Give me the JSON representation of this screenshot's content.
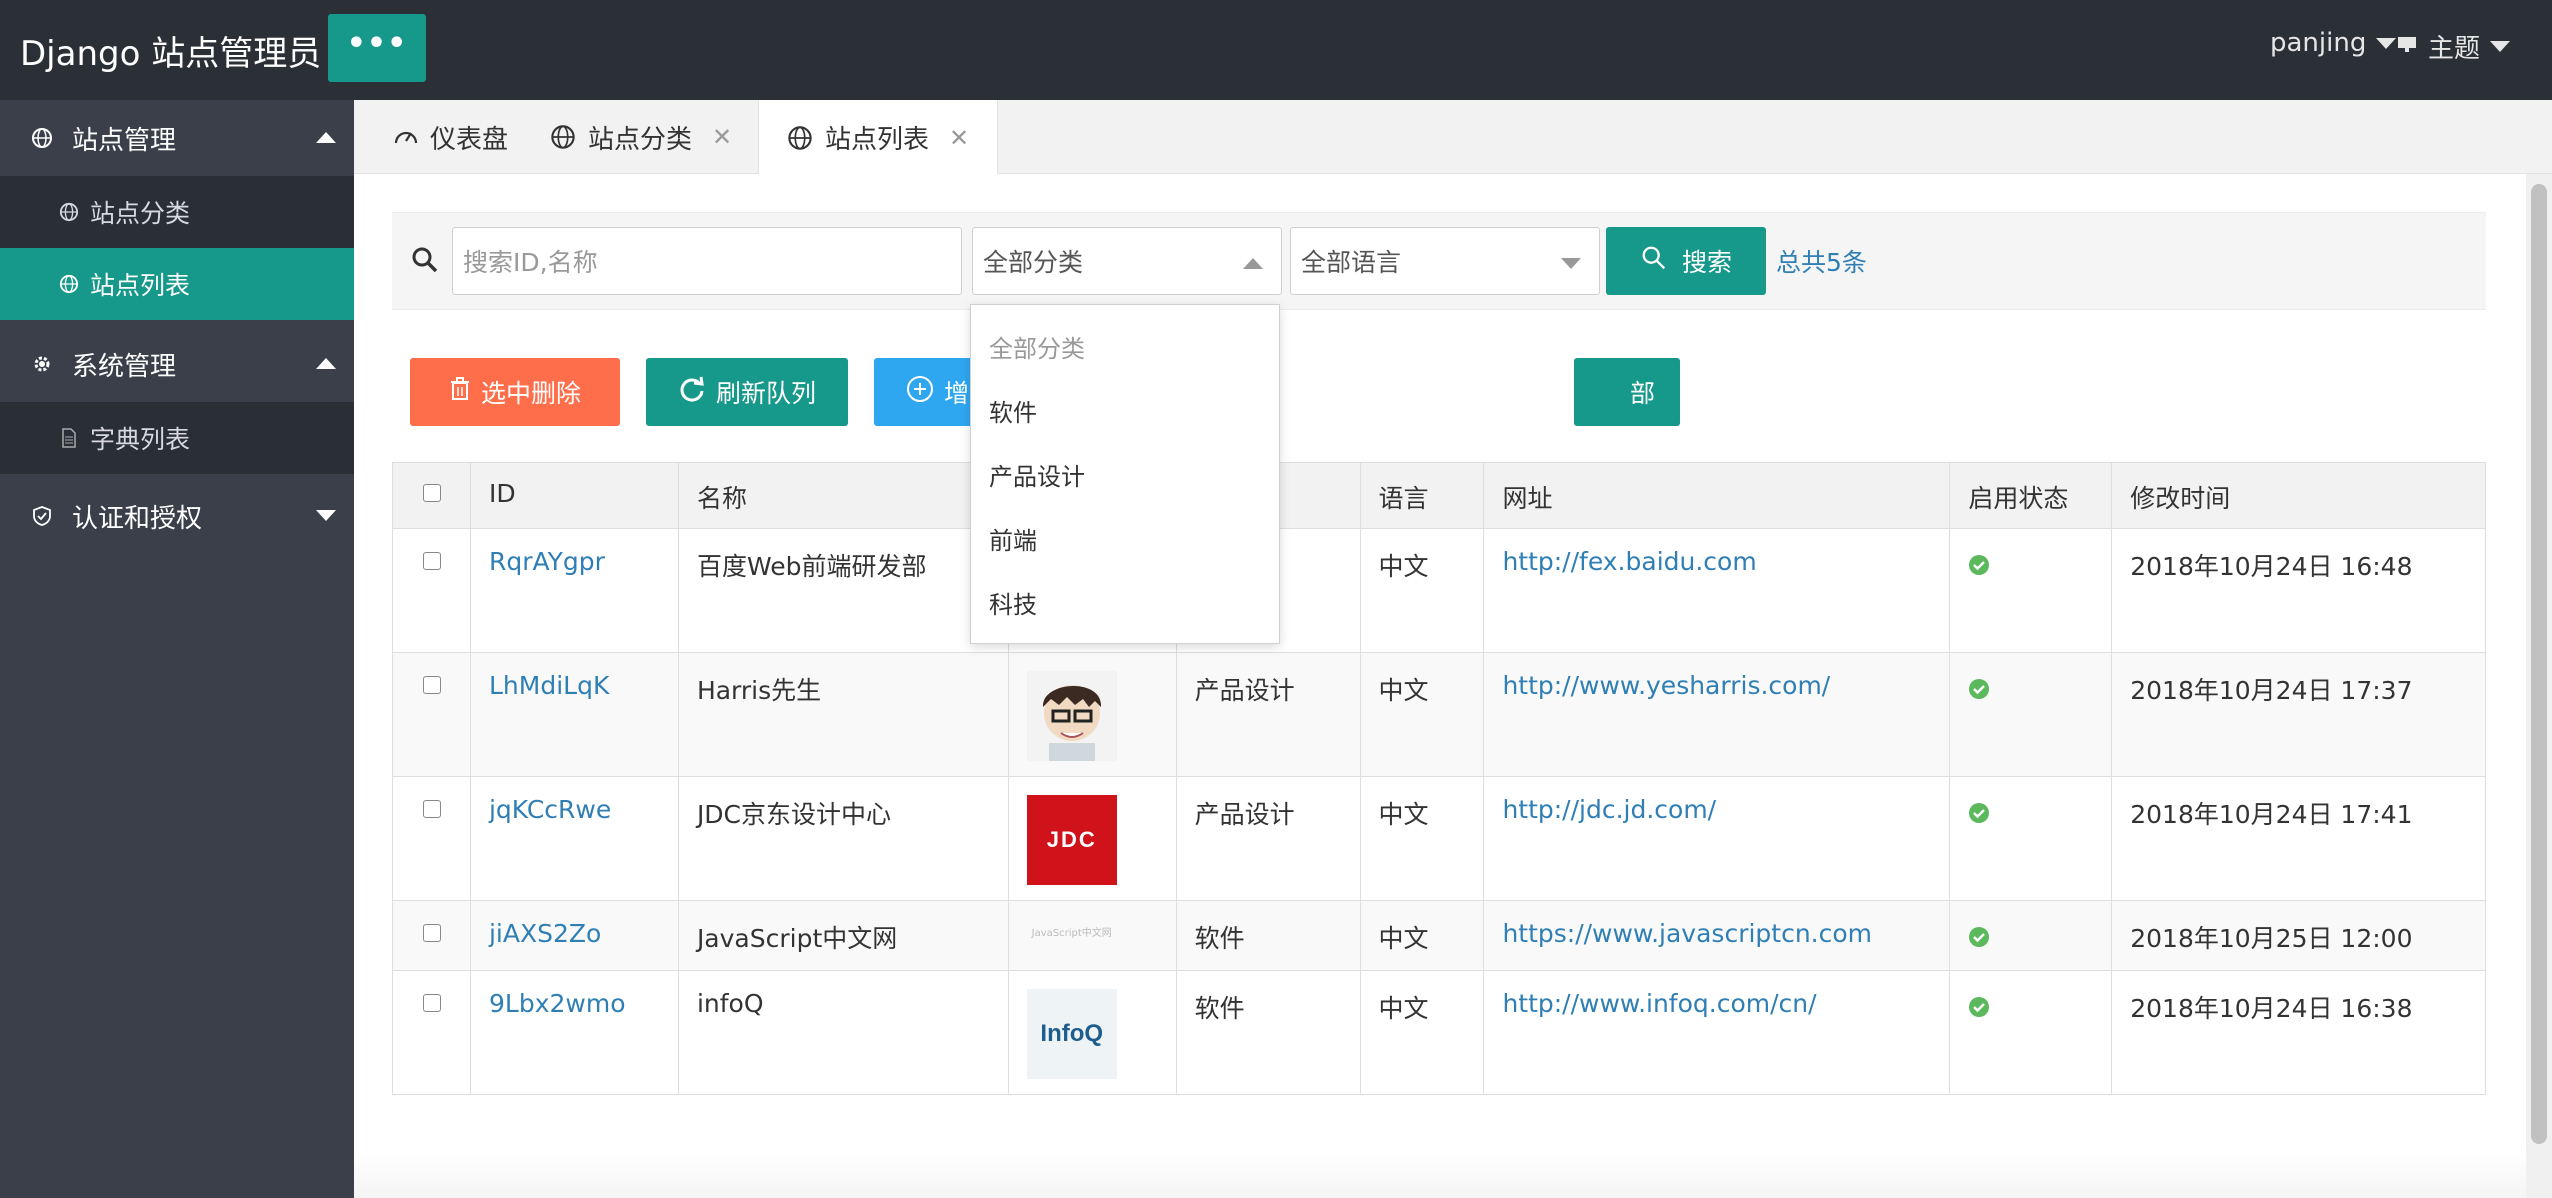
{
  "header": {
    "brand": "Django 站点管理员",
    "menu_button": "•••",
    "user": "panjing",
    "theme": "主题"
  },
  "sidebar": {
    "groups": [
      {
        "label": "站点管理",
        "expanded": true,
        "items": [
          {
            "label": "站点分类",
            "active": false
          },
          {
            "label": "站点列表",
            "active": true
          }
        ]
      },
      {
        "label": "系统管理",
        "expanded": true,
        "items": [
          {
            "label": "字典列表",
            "active": false
          }
        ]
      },
      {
        "label": "认证和授权",
        "expanded": false,
        "items": []
      }
    ]
  },
  "tabs": [
    {
      "label": "仪表盘",
      "closable": false,
      "active": false
    },
    {
      "label": "站点分类",
      "closable": true,
      "active": false
    },
    {
      "label": "站点列表",
      "closable": true,
      "active": true
    }
  ],
  "search": {
    "placeholder": "搜索ID,名称",
    "category_selected": "全部分类",
    "language_selected": "全部语言",
    "button": "搜索",
    "total": "总共5条"
  },
  "actions": {
    "delete_selected": "选中删除",
    "refresh_queue": "刷新队列",
    "add_partial": "增",
    "hidden_partial": "部"
  },
  "table": {
    "headers": [
      "",
      "ID",
      "名称",
      "",
      "",
      "语言",
      "网址",
      "启用状态",
      "修改时间"
    ],
    "rows": [
      {
        "id": "RqrAYgpr",
        "name": "百度Web前端研发部",
        "category": "",
        "language": "中文",
        "url": "http://fex.baidu.com",
        "enabled": true,
        "modified": "2018年10月24日 16:48",
        "thumb": ""
      },
      {
        "id": "LhMdiLqK",
        "name": "Harris先生",
        "category": "产品设计",
        "language": "中文",
        "url": "http://www.yesharris.com/",
        "enabled": true,
        "modified": "2018年10月24日 17:37",
        "thumb": "avatar"
      },
      {
        "id": "jqKCcRwe",
        "name": "JDC京东设计中心",
        "category": "产品设计",
        "language": "中文",
        "url": "http://jdc.jd.com/",
        "enabled": true,
        "modified": "2018年10月24日 17:41",
        "thumb": "JDC"
      },
      {
        "id": "jiAXS2Zo",
        "name": "JavaScript中文网",
        "category": "软件",
        "language": "中文",
        "url": "https://www.javascriptcn.com",
        "enabled": true,
        "modified": "2018年10月25日 12:00",
        "thumb": "JavaScript中文网"
      },
      {
        "id": "9Lbx2wmo",
        "name": "infoQ",
        "category": "软件",
        "language": "中文",
        "url": "http://www.infoq.com/cn/",
        "enabled": true,
        "modified": "2018年10月24日 16:38",
        "thumb": "InfoQ"
      }
    ]
  },
  "dropdown": {
    "options": [
      "全部分类",
      "软件",
      "产品设计",
      "前端",
      "科技"
    ]
  },
  "colors": {
    "teal": "#16988a",
    "orange": "#ff6e4a",
    "blue": "#2ea7f0",
    "link": "#2f7fb5",
    "header_bg": "#2b2f36",
    "sidebar_bg": "#3a3f4a",
    "ok_green": "#5cb85c"
  },
  "icons": {
    "search": "search-icon",
    "globe": "globe-icon",
    "gear": "gear-icon",
    "shield": "shield-icon",
    "doc": "document-icon",
    "dashboard": "dashboard-icon",
    "trash": "trash-icon",
    "refresh": "refresh-icon",
    "plus": "plus-circle-icon",
    "check": "check-circle-icon"
  }
}
